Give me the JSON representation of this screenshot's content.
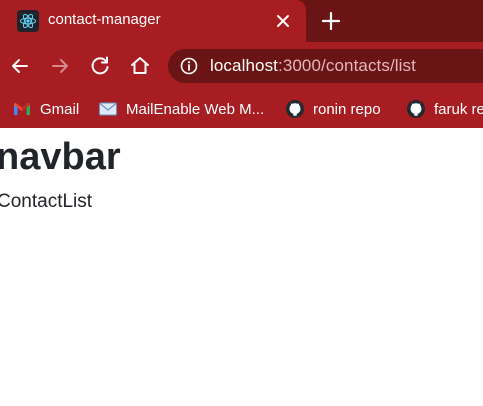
{
  "browser": {
    "tab": {
      "title": "contact-manager",
      "icon": "react-logo-icon"
    },
    "address_bar": {
      "host": "localhost",
      "rest": ":3000/contacts/list"
    },
    "bookmarks": [
      {
        "label": "Gmail",
        "icon": "gmail-icon"
      },
      {
        "label": "MailEnable Web M...",
        "icon": "mail-envelope-icon"
      },
      {
        "label": "ronin repo",
        "icon": "github-icon"
      },
      {
        "label": "faruk re",
        "icon": "github-icon"
      }
    ],
    "colors": {
      "frame": "#a71d22",
      "tabstrip": "#6b1416",
      "text": "#ffffff"
    }
  },
  "page": {
    "heading": "navbar",
    "body_text": "ContactList"
  }
}
